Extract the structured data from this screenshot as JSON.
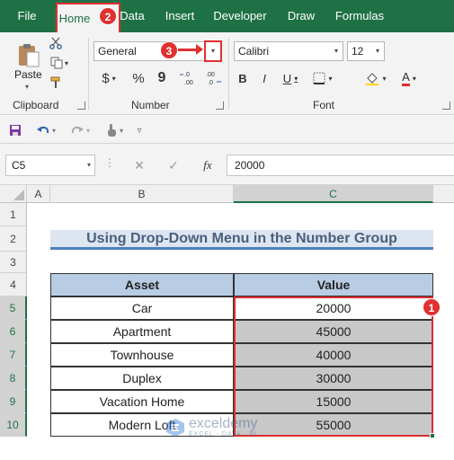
{
  "tabs": [
    {
      "label": "File",
      "active": false
    },
    {
      "label": "Home",
      "active": true
    },
    {
      "label": "Data",
      "active": false
    },
    {
      "label": "Insert",
      "active": false
    },
    {
      "label": "Developer",
      "active": false
    },
    {
      "label": "Draw",
      "active": false
    },
    {
      "label": "Formulas",
      "active": false
    }
  ],
  "badges": {
    "one": "1",
    "two": "2",
    "three": "3"
  },
  "ribbon": {
    "clipboard": {
      "paste_label": "Paste",
      "group_label": "Clipboard"
    },
    "number": {
      "format_value": "General",
      "group_label": "Number",
      "currency": "$",
      "percent": "%",
      "comma": "9",
      "inc_decimal": "←.0\n.00",
      "dec_decimal": ".00\n→.0"
    },
    "font": {
      "font_name": "Calibri",
      "font_size": "12",
      "group_label": "Font",
      "bold": "B",
      "italic": "I",
      "underline": "U",
      "font_color_letter": "A"
    }
  },
  "formula_bar": {
    "name_box": "C5",
    "fx_label": "fx",
    "formula_value": "20000"
  },
  "sheet": {
    "columns": [
      "A",
      "B",
      "C"
    ],
    "rows": [
      "1",
      "2",
      "3",
      "4",
      "5",
      "6",
      "7",
      "8",
      "9",
      "10"
    ],
    "title": "Using Drop-Down Menu in the Number Group",
    "table_headers": [
      "Asset",
      "Value"
    ],
    "table_rows": [
      {
        "asset": "Car",
        "value": "20000"
      },
      {
        "asset": "Apartment",
        "value": "45000"
      },
      {
        "asset": "Townhouse",
        "value": "40000"
      },
      {
        "asset": "Duplex",
        "value": "30000"
      },
      {
        "asset": "Vacation Home",
        "value": "15000"
      },
      {
        "asset": "Modern Loft",
        "value": "55000"
      }
    ]
  },
  "watermark": {
    "name": "exceldemy",
    "tagline": "EXCEL · DATA · BI"
  },
  "colors": {
    "excel_green": "#1e7145",
    "highlight_red": "#e03030",
    "header_blue": "#b8cce4",
    "title_bg": "#dde5f1"
  }
}
